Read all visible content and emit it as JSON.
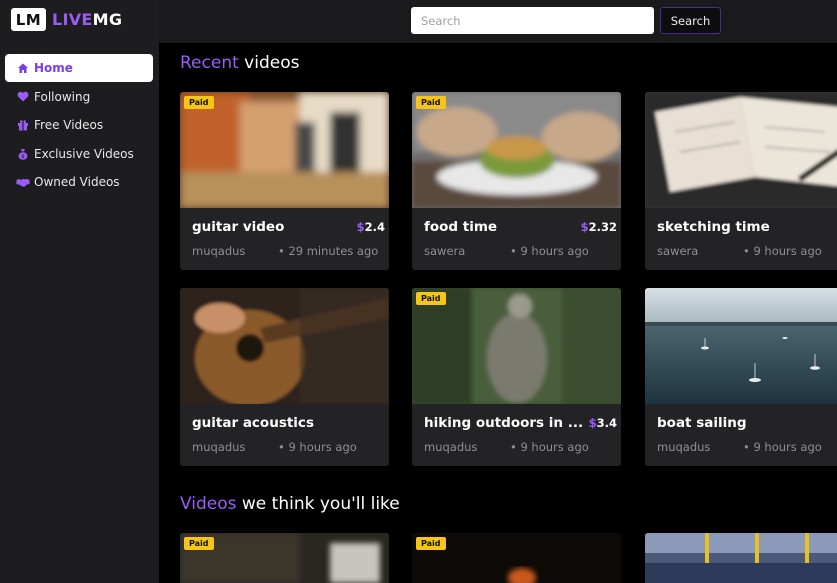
{
  "logo": {
    "box": "LM",
    "live": "LIVE",
    "mg": "MG"
  },
  "sidebar": {
    "items": [
      {
        "label": "Home",
        "icon": "home-icon",
        "glyph": "⌂",
        "active": true
      },
      {
        "label": "Following",
        "icon": "heart-icon",
        "glyph": "♥",
        "active": false
      },
      {
        "label": "Free Videos",
        "icon": "gift-icon",
        "glyph": "▣",
        "active": false
      },
      {
        "label": "Exclusive Videos",
        "icon": "bag-icon",
        "glyph": "◆",
        "active": false
      },
      {
        "label": "Owned Videos",
        "icon": "handshake-icon",
        "glyph": "◈",
        "active": false
      }
    ]
  },
  "search": {
    "placeholder": "Search",
    "button_label": "Search"
  },
  "sections": {
    "recent": {
      "accent": "Recent",
      "rest": " videos"
    },
    "recommended": {
      "accent": "Videos",
      "rest": " we think you'll like"
    }
  },
  "paid_label": "Paid",
  "recent_videos": [
    {
      "title": "guitar video",
      "price": "2.4",
      "author": "muqadus",
      "time": "• 29 minutes ago",
      "paid": true
    },
    {
      "title": "food time",
      "price": "2.32",
      "author": "sawera",
      "time": "• 9 hours ago",
      "paid": true
    },
    {
      "title": "sketching time",
      "price": "",
      "author": "sawera",
      "time": "• 9 hours ago",
      "paid": false
    },
    {
      "title": "guitar acoustics",
      "price": "",
      "author": "muqadus",
      "time": "• 9 hours ago",
      "paid": false
    },
    {
      "title": "hiking outdoors in ...",
      "price": "3.4",
      "author": "muqadus",
      "time": "• 9 hours ago",
      "paid": true
    },
    {
      "title": "boat sailing",
      "price": "",
      "author": "muqadus",
      "time": "• 9 hours ago",
      "paid": false
    }
  ],
  "recommended_videos": [
    {
      "paid": true
    },
    {
      "paid": true
    },
    {
      "paid": false
    }
  ],
  "colors": {
    "accent": "#9b5cf6",
    "paid_badge": "#f5c518",
    "card_bg": "#232325"
  }
}
